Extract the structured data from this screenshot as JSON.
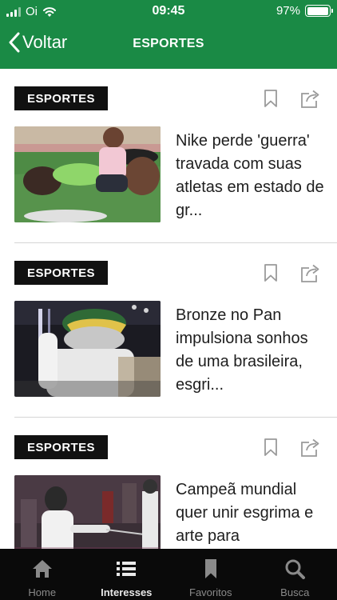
{
  "status_bar": {
    "carrier": "Oi",
    "time": "09:45",
    "battery_percent": "97%",
    "battery_level": 0.97
  },
  "nav": {
    "back_label": "Voltar",
    "title": "ESPORTES"
  },
  "colors": {
    "header_bg": "#1a8a45",
    "tag_bg": "#111111",
    "tabbar_bg": "#0a0a0a"
  },
  "articles": [
    {
      "tag": "ESPORTES",
      "headline": "Nike perde 'guerra' travada com suas atletas em estado de gr..."
    },
    {
      "tag": "ESPORTES",
      "headline": "Bronze no Pan impulsiona sonhos de uma brasileira, esgri..."
    },
    {
      "tag": "ESPORTES",
      "headline": "Campeã mundial quer unir esgrima e arte para"
    }
  ],
  "tabs": [
    {
      "label": "Home",
      "icon": "home-icon"
    },
    {
      "label": "Interesses",
      "icon": "list-icon",
      "active": true
    },
    {
      "label": "Favoritos",
      "icon": "bookmark-icon"
    },
    {
      "label": "Busca",
      "icon": "search-icon"
    }
  ]
}
